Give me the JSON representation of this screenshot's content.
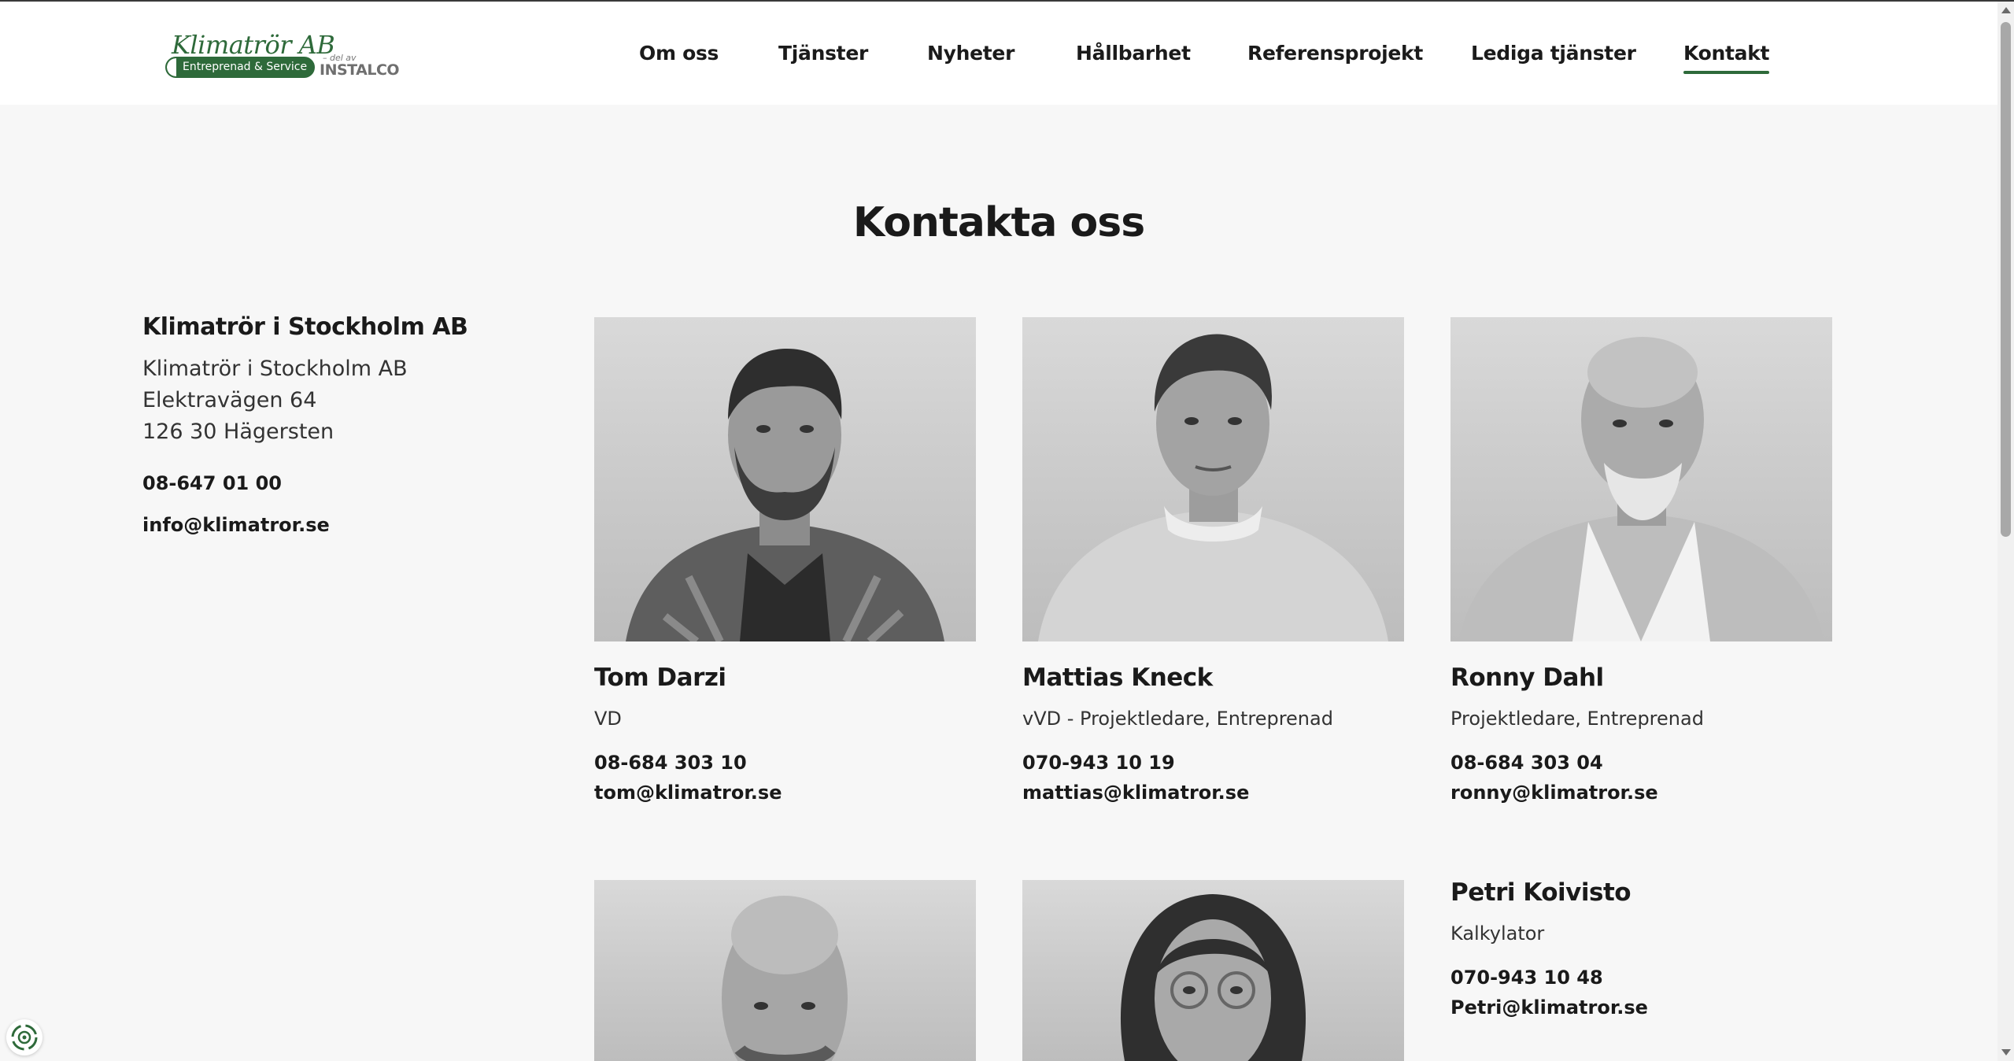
{
  "header": {
    "logo": {
      "name": "Klimatrör AB",
      "tagline": "Entreprenad & Service",
      "partner_prefix": "– del av",
      "partner": "INSTALCO"
    },
    "nav": [
      {
        "label": "Om oss",
        "active": false
      },
      {
        "label": "Tjänster",
        "active": false
      },
      {
        "label": "Nyheter",
        "active": false
      },
      {
        "label": "Hållbarhet",
        "active": false
      },
      {
        "label": "Referensprojekt",
        "active": false
      },
      {
        "label": "Lediga tjänster",
        "active": false
      },
      {
        "label": "Kontakt",
        "active": true
      }
    ]
  },
  "main": {
    "title": "Kontakta oss",
    "company": {
      "heading": "Klimatrör i Stockholm AB",
      "address_lines": [
        "Klimatrör i Stockholm AB",
        "Elektravägen 64",
        "126 30 Hägersten"
      ],
      "phone": "08-647 01 00",
      "email": "info@klimatror.se"
    },
    "people": [
      {
        "name": "Tom Darzi",
        "role": "VD",
        "phone": "08-684 303 10",
        "email": "tom@klimatror.se",
        "photo": "portrait-photo"
      },
      {
        "name": "Mattias Kneck",
        "role": "vVD - Projektledare, Entreprenad",
        "phone": "070-943 10 19",
        "email": "mattias@klimatror.se",
        "photo": "portrait-photo"
      },
      {
        "name": "Ronny Dahl",
        "role": "Projektledare, Entreprenad",
        "phone": "08-684 303 04",
        "email": "ronny@klimatror.se",
        "photo": "portrait-photo"
      },
      {
        "name": "Petri Koivisto",
        "role": "Kalkylator",
        "phone": "070-943 10 48",
        "email": "Petri@klimatror.se",
        "photo": null
      }
    ]
  },
  "widgets": {
    "cookie_icon": "cookie-settings-icon"
  },
  "colors": {
    "accent": "#2e6a3a",
    "background": "#f7f7f7",
    "header": "#ffffff",
    "text": "#1a1a1a"
  }
}
